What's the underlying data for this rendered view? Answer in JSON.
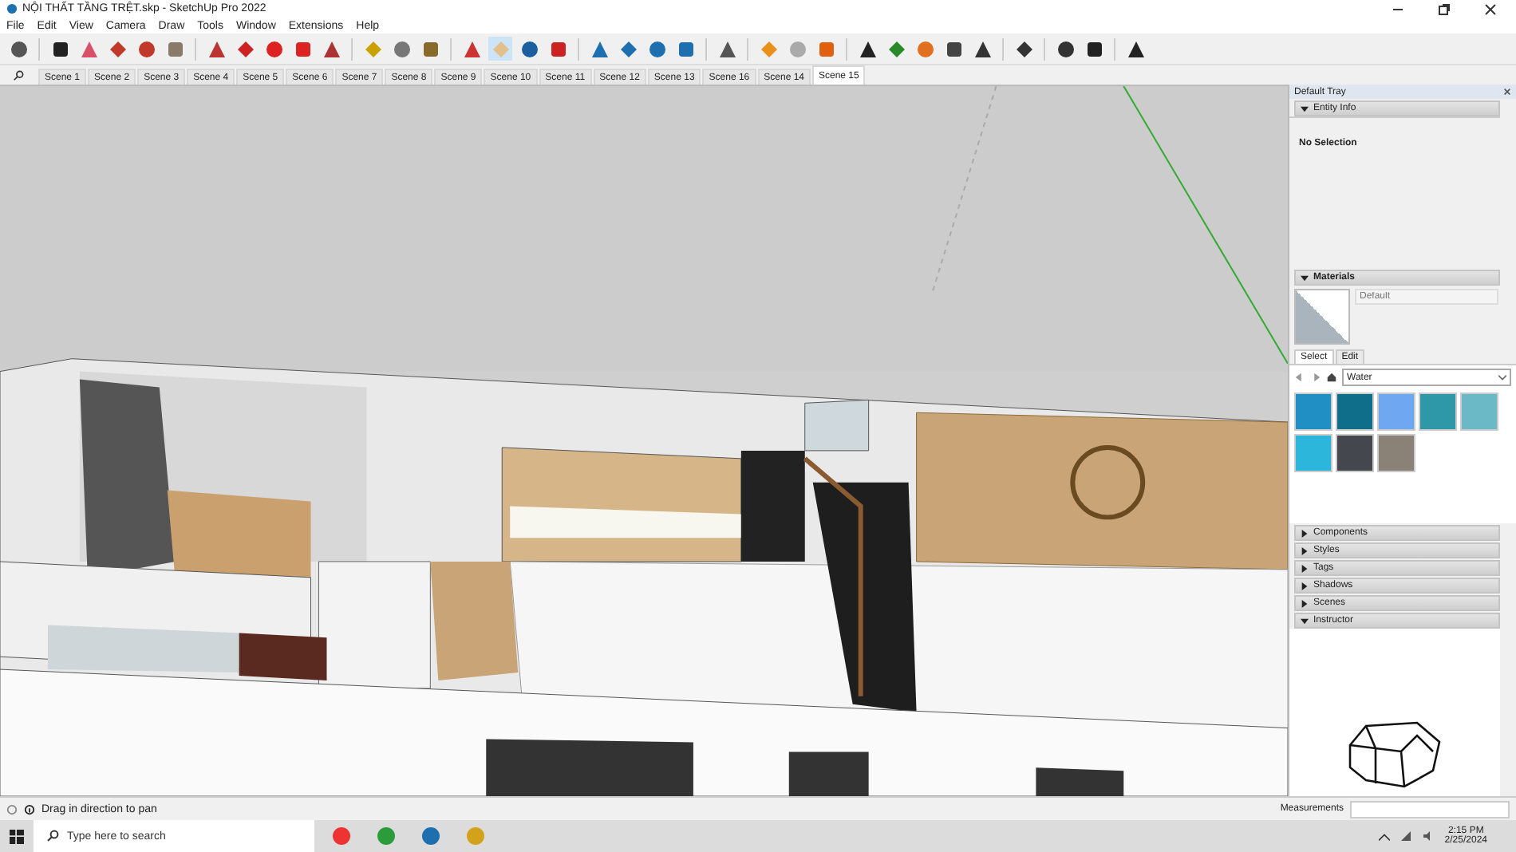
{
  "window": {
    "title": "NỘI THẤT TẦNG TRỆT.skp - SketchUp Pro 2022"
  },
  "menu": [
    "File",
    "Edit",
    "View",
    "Camera",
    "Draw",
    "Tools",
    "Window",
    "Extensions",
    "Help"
  ],
  "scenes": [
    {
      "label": "Scene 1",
      "selected": false
    },
    {
      "label": "Scene 2",
      "selected": false
    },
    {
      "label": "Scene 3",
      "selected": false
    },
    {
      "label": "Scene 4",
      "selected": false
    },
    {
      "label": "Scene 5",
      "selected": false
    },
    {
      "label": "Scene 6",
      "selected": false
    },
    {
      "label": "Scene 7",
      "selected": false
    },
    {
      "label": "Scene 8",
      "selected": false
    },
    {
      "label": "Scene 9",
      "selected": false
    },
    {
      "label": "Scene 10",
      "selected": false
    },
    {
      "label": "Scene 11",
      "selected": false
    },
    {
      "label": "Scene 12",
      "selected": false
    },
    {
      "label": "Scene 13",
      "selected": false
    },
    {
      "label": "Scene 16",
      "selected": false
    },
    {
      "label": "Scene 14",
      "selected": false
    },
    {
      "label": "Scene 15",
      "selected": true
    }
  ],
  "tray": {
    "title": "Default Tray",
    "entity_info": {
      "title": "Entity Info",
      "expanded": true,
      "value": "No Selection"
    },
    "materials": {
      "title": "Materials",
      "expanded": true,
      "name_placeholder": "Default",
      "tabs": [
        {
          "label": "Select",
          "selected": true
        },
        {
          "label": "Edit",
          "selected": false
        }
      ],
      "library": "Water",
      "swatches": [
        {
          "color": "#1f8fc4"
        },
        {
          "color": "#0f6f8a"
        },
        {
          "color": "#6fa8f0"
        },
        {
          "color": "#2e97a8"
        },
        {
          "color": "#6bb9c6"
        },
        {
          "color": "#2db6dc"
        },
        {
          "color": "#45474f"
        },
        {
          "color": "#8a8276"
        }
      ]
    },
    "panels": [
      {
        "title": "Components",
        "expanded": false
      },
      {
        "title": "Styles",
        "expanded": false
      },
      {
        "title": "Tags",
        "expanded": false
      },
      {
        "title": "Shadows",
        "expanded": false
      },
      {
        "title": "Scenes",
        "expanded": false
      },
      {
        "title": "Instructor",
        "expanded": true
      }
    ]
  },
  "status": {
    "text": "Drag in direction to pan",
    "measurements_label": "Measurements"
  },
  "taskbar": {
    "search_placeholder": "Type here to search",
    "time": "2:15 PM",
    "date": "2/25/2024"
  }
}
